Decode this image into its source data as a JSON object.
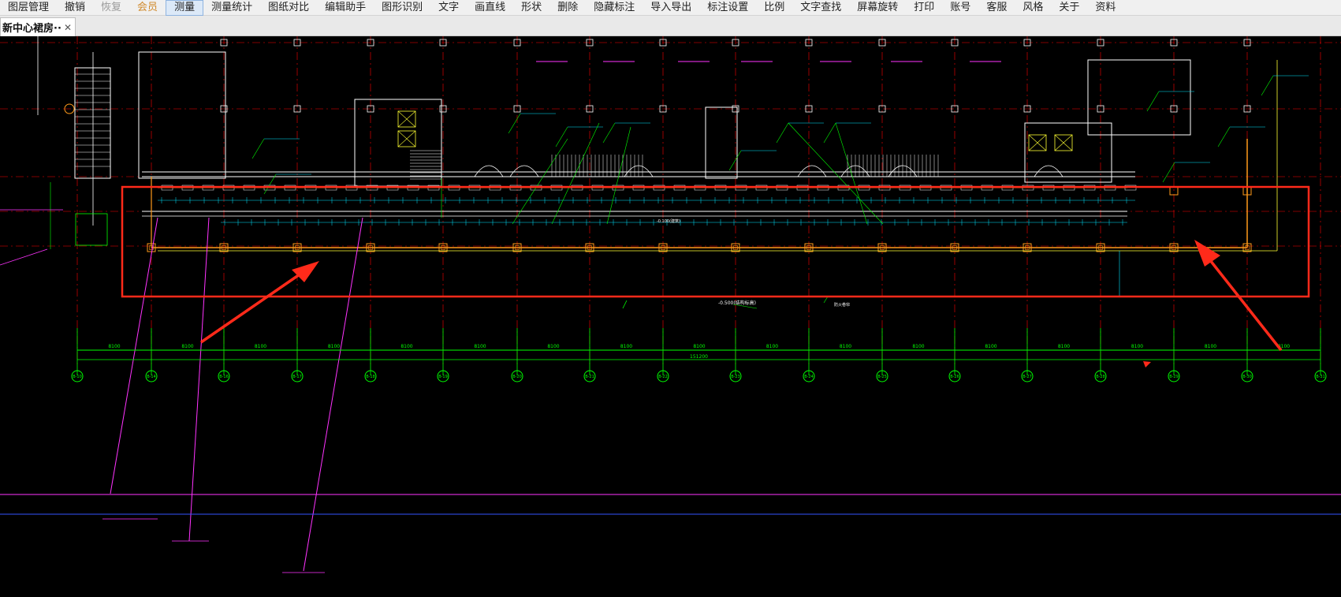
{
  "menu": {
    "items": [
      {
        "id": "layer-manage",
        "label": "图层管理",
        "state": "normal"
      },
      {
        "id": "undo",
        "label": "撤销",
        "state": "normal"
      },
      {
        "id": "redo",
        "label": "恢复",
        "state": "disabled"
      },
      {
        "id": "member",
        "label": "会员",
        "state": "vip"
      },
      {
        "id": "measure",
        "label": "测量",
        "state": "active"
      },
      {
        "id": "measure-stats",
        "label": "测量统计",
        "state": "normal"
      },
      {
        "id": "drawing-compare",
        "label": "图纸对比",
        "state": "normal"
      },
      {
        "id": "edit-assistant",
        "label": "编辑助手",
        "state": "normal"
      },
      {
        "id": "shape-recognition",
        "label": "图形识别",
        "state": "normal"
      },
      {
        "id": "text",
        "label": "文字",
        "state": "normal"
      },
      {
        "id": "draw-line",
        "label": "画直线",
        "state": "normal"
      },
      {
        "id": "shape",
        "label": "形状",
        "state": "normal"
      },
      {
        "id": "delete",
        "label": "删除",
        "state": "normal"
      },
      {
        "id": "hide-annotation",
        "label": "隐藏标注",
        "state": "normal"
      },
      {
        "id": "import-export",
        "label": "导入导出",
        "state": "normal"
      },
      {
        "id": "annotation-settings",
        "label": "标注设置",
        "state": "normal"
      },
      {
        "id": "scale",
        "label": "比例",
        "state": "normal"
      },
      {
        "id": "text-search",
        "label": "文字查找",
        "state": "normal"
      },
      {
        "id": "screen-rotate",
        "label": "屏幕旋转",
        "state": "normal"
      },
      {
        "id": "print",
        "label": "打印",
        "state": "normal"
      },
      {
        "id": "account",
        "label": "账号",
        "state": "normal"
      },
      {
        "id": "support",
        "label": "客服",
        "state": "normal"
      },
      {
        "id": "style",
        "label": "风格",
        "state": "normal"
      },
      {
        "id": "about",
        "label": "关于",
        "state": "normal"
      },
      {
        "id": "resources",
        "label": "资料",
        "state": "normal"
      }
    ]
  },
  "tab": {
    "title": "新中心裙房···",
    "close_glyph": "✕"
  },
  "drawing": {
    "colors": {
      "background": "#000000",
      "grid": "#00ff00",
      "axis": "#ff0000",
      "highlight": "#ff2a1a",
      "walls": "#ffffff",
      "orange": "#ff9a1a",
      "magenta": "#ff33ff",
      "cyan": "#00e5ff",
      "yellow": "#ffff33",
      "blue": "#3355ff"
    },
    "axis_labels": [
      "B-10",
      "B-14",
      "B-16",
      "B-17",
      "B-18",
      "B-19",
      "B-20",
      "B-21",
      "B-22",
      "B-23",
      "B-24",
      "B-25",
      "B-26",
      "B-27",
      "B-28",
      "B-29",
      "B-30",
      "B-31"
    ],
    "span_labels": [
      "8100",
      "8100",
      "8100",
      "8100",
      "8100",
      "8100",
      "8100",
      "8100",
      "8100",
      "8100",
      "8100",
      "8100",
      "8100",
      "8100",
      "8100",
      "8100",
      "8100"
    ],
    "total_span_label": "151200",
    "notes": [
      "-0.500(结构标高)",
      "-0.100(建筑)",
      "防火卷帘"
    ]
  }
}
